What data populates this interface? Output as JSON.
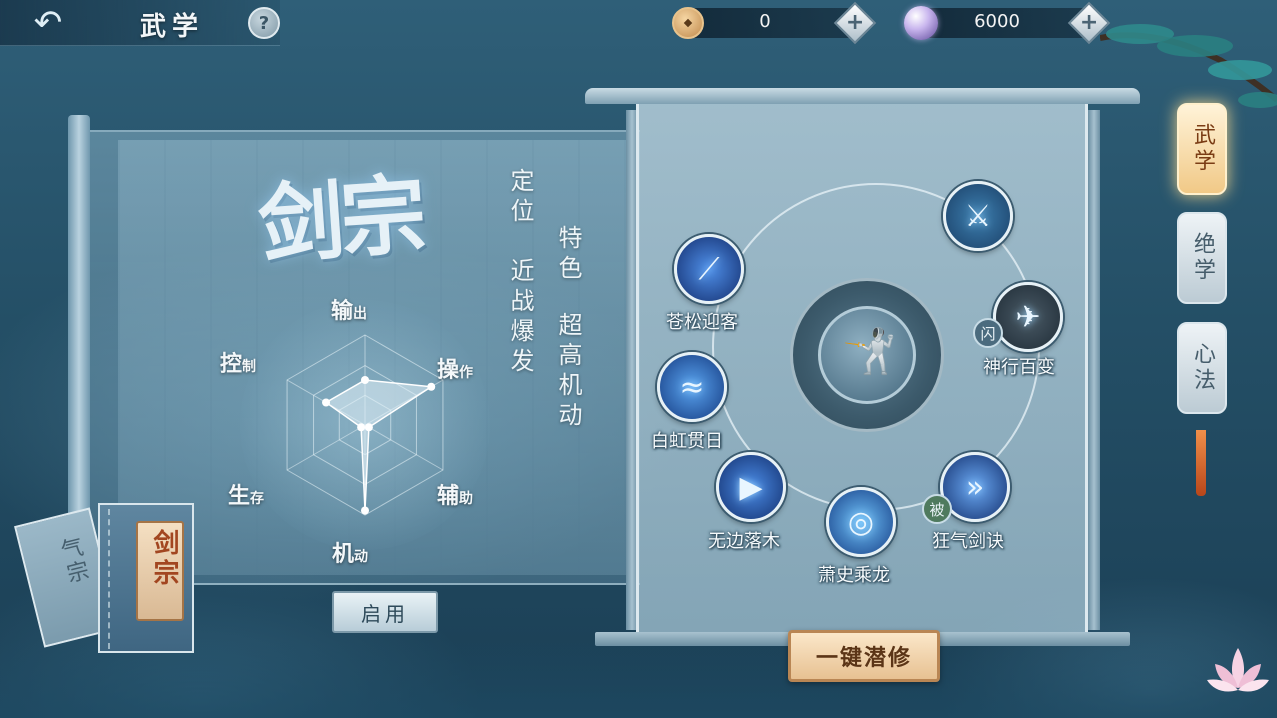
{
  "header": {
    "back_icon": "back-arrow-icon",
    "title": "武学",
    "help_label": "?"
  },
  "currencies": [
    {
      "icon": "copper-coin-icon",
      "value": "0"
    },
    {
      "icon": "spirit-pearl-icon",
      "value": "6000"
    }
  ],
  "class_info": {
    "name": "剑宗",
    "positioning_label": "定位",
    "positioning_value": "近战爆发",
    "feature_label": "特色",
    "feature_value": "超高机动"
  },
  "radar": {
    "axes": [
      {
        "main": "输",
        "sub": "出",
        "value": 0.5
      },
      {
        "main": "操",
        "sub": "作",
        "value": 0.85
      },
      {
        "main": "辅",
        "sub": "助",
        "value": 0.05
      },
      {
        "main": "机",
        "sub": "动",
        "value": 0.95
      },
      {
        "main": "生",
        "sub": "存",
        "value": 0.05
      },
      {
        "main": "控",
        "sub": "制",
        "value": 0.5
      }
    ]
  },
  "activate_label": "启用",
  "books": [
    {
      "label": "气宗",
      "selected": false
    },
    {
      "label": "剑宗",
      "selected": true
    }
  ],
  "skills": [
    {
      "name": "苍松迎客",
      "icon": "blue-sword-slash-icon"
    },
    {
      "name": "白虹贯日",
      "icon": "blue-wave-icon"
    },
    {
      "name": "无边落木",
      "icon": "blue-triangle-strike-icon"
    },
    {
      "name": "萧史乘龙",
      "icon": "blue-vortex-icon"
    },
    {
      "name": "狂气剑诀",
      "icon": "blue-arrow-icon",
      "tag": "被"
    },
    {
      "name": "神行百变",
      "icon": "dash-figure-icon",
      "tag": "闪"
    },
    {
      "name": "",
      "icon": "triple-sword-icon"
    }
  ],
  "center_icon": "martial-pose-icon",
  "cultivate_label": "一键潜修",
  "side_tabs": [
    {
      "label": "武学",
      "active": true
    },
    {
      "label": "绝学",
      "active": false
    },
    {
      "label": "心法",
      "active": false
    }
  ],
  "colors": {
    "background": "#2f5f78",
    "accent_gold": "#f1c987",
    "skill_blue": "#3f7de0"
  }
}
